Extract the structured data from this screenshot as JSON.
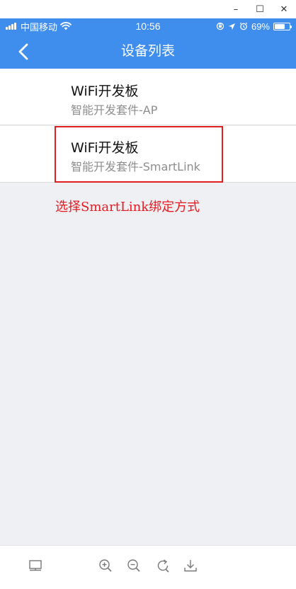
{
  "window": {
    "minimize_glyph": "–",
    "maximize_glyph": "☐",
    "close_glyph": "✕"
  },
  "status_bar": {
    "carrier": "中国移动",
    "time": "10:56",
    "battery_text": "69%",
    "battery_level": 0.69,
    "icons": [
      "signal-icon",
      "wifi-icon",
      "orientation-lock-icon",
      "location-icon",
      "alarm-icon",
      "battery-icon"
    ]
  },
  "nav": {
    "title": "设备列表",
    "back_icon": "chevron-left-icon"
  },
  "devices": [
    {
      "title": "WiFi开发板",
      "subtitle": "智能开发套件-AP"
    },
    {
      "title": "WiFi开发板",
      "subtitle": "智能开发套件-SmartLink"
    }
  ],
  "annotation": {
    "text": "选择SmartLink绑定方式",
    "color": "#e8191f"
  },
  "toolbar": {
    "icons": [
      "layout-icon",
      "zoom-in-icon",
      "zoom-out-icon",
      "rotate-icon",
      "download-icon"
    ]
  },
  "colors": {
    "brand": "#3f8ded",
    "background": "#eff0f4",
    "highlight": "#e02020"
  }
}
